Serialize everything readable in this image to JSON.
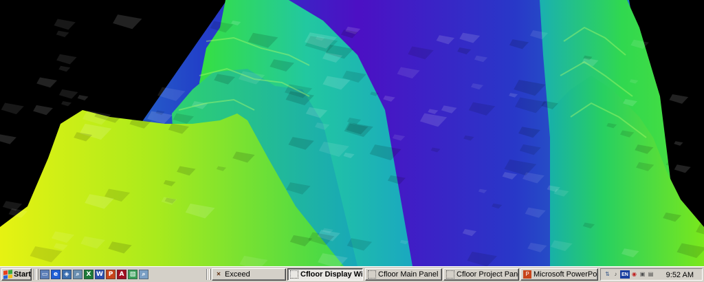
{
  "viewport": {
    "colors": {
      "background": "#000000",
      "low": "#4b10c8",
      "mid": "#16a8c0",
      "high": "#3ee64a",
      "peak": "#f2f20c"
    }
  },
  "taskbar": {
    "start_label": "Start",
    "quick_launch": [
      {
        "icon": "show-desktop-icon",
        "glyph": "▭",
        "color": "#5c7fb8"
      },
      {
        "icon": "internet-explorer-icon",
        "glyph": "e",
        "color": "#1f5fd6"
      },
      {
        "icon": "network-icon",
        "glyph": "◈",
        "color": "#3c6fb0"
      },
      {
        "icon": "search-icon",
        "glyph": "⌕",
        "color": "#6a8fb0"
      },
      {
        "icon": "excel-icon",
        "glyph": "X",
        "color": "#1d7a3a"
      },
      {
        "icon": "word-icon",
        "glyph": "W",
        "color": "#2b50b0"
      },
      {
        "icon": "powerpoint-icon",
        "glyph": "P",
        "color": "#c8441a"
      },
      {
        "icon": "access-icon",
        "glyph": "A",
        "color": "#a01020"
      },
      {
        "icon": "image-viewer-icon",
        "glyph": "▧",
        "color": "#3aa05a"
      },
      {
        "icon": "explorer-search-icon",
        "glyph": "⌕",
        "color": "#7a9fc4"
      }
    ],
    "tasks": [
      {
        "label": "Exceed",
        "icon": "exceed-icon",
        "active": false
      },
      {
        "label": "Cfloor Display Win...",
        "icon": "window-icon",
        "active": true
      },
      {
        "label": "Cfloor Main Panel",
        "icon": "window-icon",
        "active": false
      },
      {
        "label": "Cfloor Project Panel",
        "icon": "window-icon",
        "active": false
      },
      {
        "label": "Microsoft PowerPoint...",
        "icon": "powerpoint-icon",
        "active": false
      }
    ],
    "tray": [
      {
        "icon": "tray-network-icon",
        "glyph": "⇅",
        "color": "#3a5a8a"
      },
      {
        "icon": "volume-icon",
        "glyph": "♪",
        "color": "#404040"
      },
      {
        "icon": "language-en-icon",
        "glyph": "EN",
        "color": "#1a3fa0"
      },
      {
        "icon": "antivirus-icon",
        "glyph": "◉",
        "color": "#c02020"
      },
      {
        "icon": "display-icon",
        "glyph": "▣",
        "color": "#505050"
      },
      {
        "icon": "printer-icon",
        "glyph": "▤",
        "color": "#404040"
      }
    ],
    "clock": "9:52 AM"
  }
}
